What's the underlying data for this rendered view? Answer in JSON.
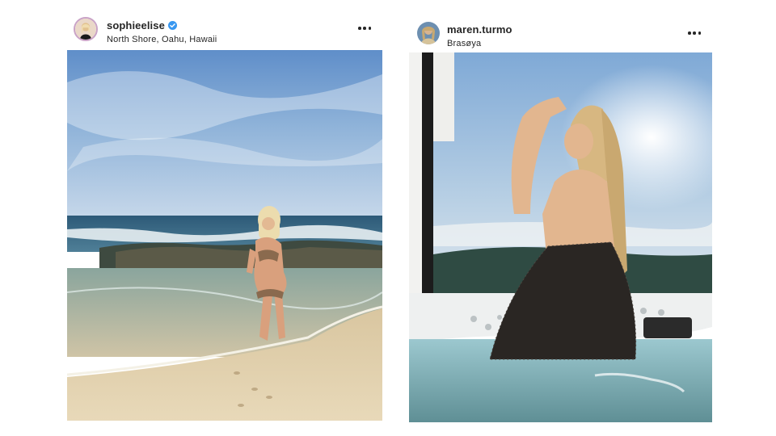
{
  "posts": [
    {
      "username": "sophieelise",
      "verified": true,
      "location": "North Shore, Oahu, Hawaii",
      "avatar_icon": "profile-avatar",
      "more_icon": "more-options-icon"
    },
    {
      "username": "maren.turmo",
      "verified": false,
      "location": "Brasøya",
      "avatar_icon": "profile-avatar",
      "more_icon": "more-options-icon"
    }
  ],
  "colors": {
    "text": "#262626",
    "verified_badge": "#3897f0",
    "story_ring": "#c9a2c6"
  }
}
